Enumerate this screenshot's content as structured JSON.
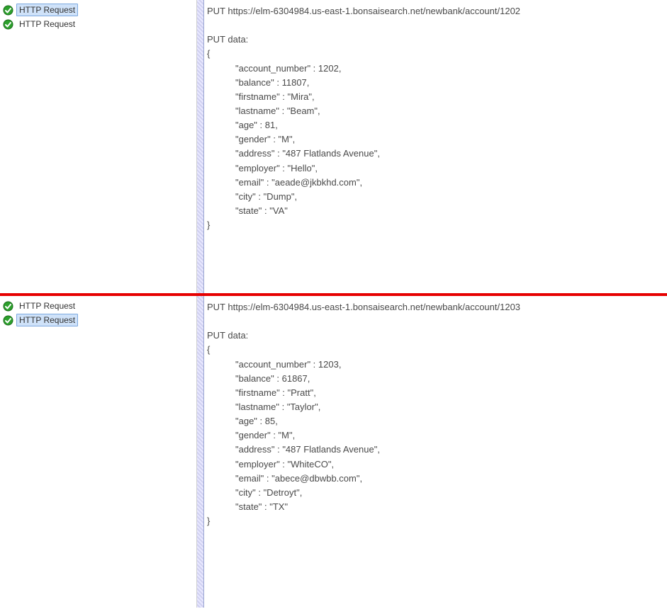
{
  "top": {
    "tree": [
      {
        "label": "HTTP Request",
        "selected": true
      },
      {
        "label": "HTTP Request",
        "selected": false
      }
    ],
    "request_line": "PUT https://elm-6304984.us-east-1.bonsaisearch.net/newbank/account/1202",
    "put_data_label": "PUT data:",
    "open_brace": "{",
    "close_brace": "}",
    "fields": {
      "account_number": "\"account_number\" : 1202,",
      "balance": "\"balance\" : 11807,",
      "firstname": "\"firstname\" : \"Mira\",",
      "lastname": "\"lastname\" : \"Beam\",",
      "age": "\"age\" : 81,",
      "gender": "\"gender\" : \"M\",",
      "address": "\"address\" : \"487 Flatlands Avenue\",",
      "employer": "\"employer\" : \"Hello\",",
      "email": "\"email\" : \"aeade@jkbkhd.com\",",
      "city": "\"city\" : \"Dump\",",
      "state": "\"state\" : \"VA\""
    }
  },
  "bottom": {
    "tree": [
      {
        "label": "HTTP Request",
        "selected": false
      },
      {
        "label": "HTTP Request",
        "selected": true
      }
    ],
    "request_line": "PUT https://elm-6304984.us-east-1.bonsaisearch.net/newbank/account/1203",
    "put_data_label": "PUT data:",
    "open_brace": "{",
    "close_brace": "}",
    "fields": {
      "account_number": "\"account_number\" : 1203,",
      "balance": "\"balance\" : 61867,",
      "firstname": "\"firstname\" : \"Pratt\",",
      "lastname": "\"lastname\" : \"Taylor\",",
      "age": "\"age\" : 85,",
      "gender": "\"gender\" : \"M\",",
      "address": "\"address\" : \"487 Flatlands Avenue\",",
      "employer": "\"employer\" : \"WhiteCO\",",
      "email": "\"email\" : \"abece@dbwbb.com\",",
      "city": "\"city\" : \"Detroyt\",",
      "state": "\"state\" : \"TX\""
    }
  }
}
